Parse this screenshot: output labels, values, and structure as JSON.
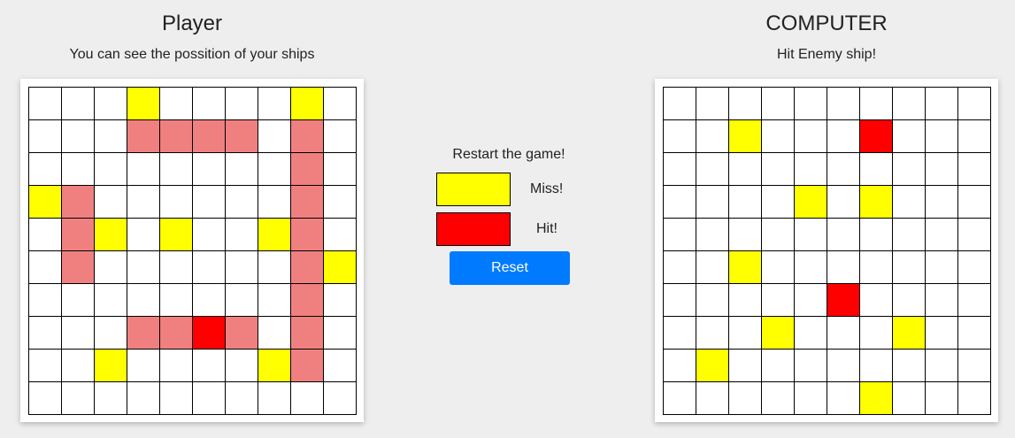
{
  "player": {
    "title": "Player",
    "subtitle": "You can see the possition of your ships"
  },
  "computer": {
    "title": "COMPUTER",
    "subtitle": "Hit Enemy ship!"
  },
  "controls": {
    "restart_label": "Restart the game!",
    "miss_label": "Miss!",
    "hit_label": "Hit!",
    "reset_label": "Reset"
  },
  "colors": {
    "empty": "#ffffff",
    "miss": "#ffff00",
    "hit": "#ff0000",
    "ship": "#f08080",
    "button": "#007bff"
  },
  "player_board": [
    "...M....M.",
    "...SSSS.S.",
    "........S.",
    "MS......S.",
    ".SM.M..MS.",
    ".S......SM",
    "........S.",
    "...SSHS.S.",
    "..M....MS.",
    ".........."
  ],
  "computer_board": [
    "..........",
    "..M...H...",
    "..........",
    "....M.M...",
    "..........",
    "..M.......",
    ".....H....",
    "...M...M..",
    ".M........",
    "......M..."
  ]
}
